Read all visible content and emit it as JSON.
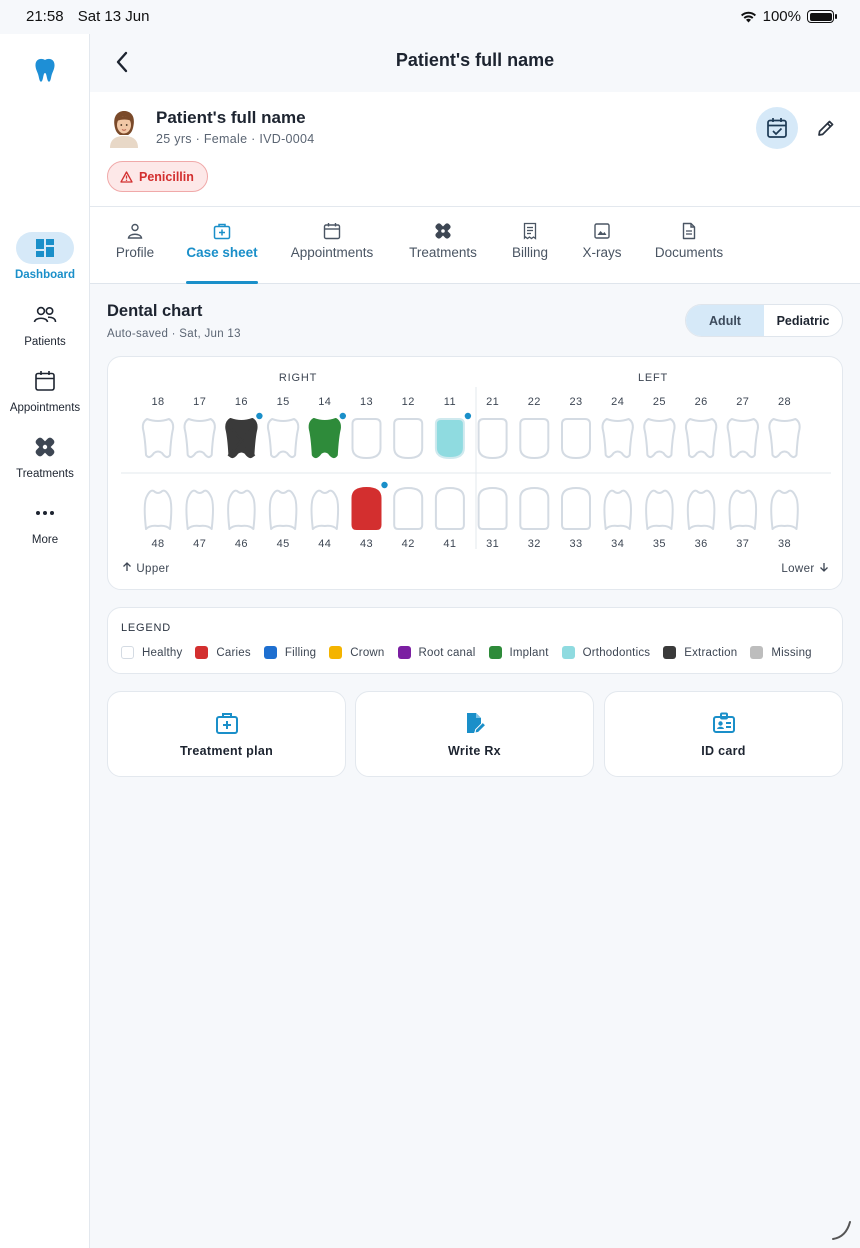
{
  "status_bar": {
    "time": "21:58",
    "date": "Sat 13 Jun",
    "battery": "100%",
    "battery_level": 1.0
  },
  "sidebar": {
    "items": [
      {
        "label": "Dashboard",
        "icon": "dashboard-icon",
        "active": true
      },
      {
        "label": "Patients",
        "icon": "patients-icon"
      },
      {
        "label": "Appointments",
        "icon": "calendar-icon"
      },
      {
        "label": "Treatments",
        "icon": "bandage-icon"
      },
      {
        "label": "More",
        "icon": "more-icon"
      }
    ]
  },
  "header": {
    "title": "Patient's full name"
  },
  "patient": {
    "name": "Patient's full name",
    "meta": "25 yrs · Female · IVD-0004",
    "allergy": "Penicillin"
  },
  "tabs": [
    {
      "label": "Profile",
      "icon": "person-icon"
    },
    {
      "label": "Case sheet",
      "icon": "medical-kit-icon",
      "active": true
    },
    {
      "label": "Appointments",
      "icon": "calendar-icon"
    },
    {
      "label": "Treatments",
      "icon": "bandage-icon"
    },
    {
      "label": "Billing",
      "icon": "receipt-icon"
    },
    {
      "label": "X-rays",
      "icon": "image-icon"
    },
    {
      "label": "Documents",
      "icon": "document-icon"
    }
  ],
  "dental_chart": {
    "title": "Dental chart",
    "subtitle": "Auto-saved · Sat, Jun 13",
    "mode_options": [
      "Adult",
      "Pediatric"
    ],
    "selected_mode": "Adult",
    "right_label": "RIGHT",
    "left_label": "LEFT",
    "upper_label": "Upper",
    "lower_label": "Lower",
    "upper_teeth": [
      {
        "num": "18",
        "status": "healthy"
      },
      {
        "num": "17",
        "status": "healthy"
      },
      {
        "num": "16",
        "status": "extraction",
        "note": true
      },
      {
        "num": "15",
        "status": "healthy"
      },
      {
        "num": "14",
        "status": "implant",
        "note": true
      },
      {
        "num": "13",
        "status": "healthy"
      },
      {
        "num": "12",
        "status": "healthy"
      },
      {
        "num": "11",
        "status": "orthodontics",
        "note": true
      },
      {
        "num": "21",
        "status": "healthy"
      },
      {
        "num": "22",
        "status": "healthy"
      },
      {
        "num": "23",
        "status": "healthy"
      },
      {
        "num": "24",
        "status": "healthy"
      },
      {
        "num": "25",
        "status": "healthy"
      },
      {
        "num": "26",
        "status": "healthy"
      },
      {
        "num": "27",
        "status": "healthy"
      },
      {
        "num": "28",
        "status": "healthy"
      }
    ],
    "lower_teeth": [
      {
        "num": "48",
        "status": "healthy"
      },
      {
        "num": "47",
        "status": "healthy"
      },
      {
        "num": "46",
        "status": "healthy"
      },
      {
        "num": "45",
        "status": "healthy"
      },
      {
        "num": "44",
        "status": "healthy"
      },
      {
        "num": "43",
        "status": "caries",
        "note": true
      },
      {
        "num": "42",
        "status": "healthy"
      },
      {
        "num": "41",
        "status": "healthy"
      },
      {
        "num": "31",
        "status": "healthy"
      },
      {
        "num": "32",
        "status": "healthy"
      },
      {
        "num": "33",
        "status": "healthy"
      },
      {
        "num": "34",
        "status": "healthy"
      },
      {
        "num": "35",
        "status": "healthy"
      },
      {
        "num": "36",
        "status": "healthy"
      },
      {
        "num": "37",
        "status": "healthy"
      },
      {
        "num": "38",
        "status": "healthy"
      }
    ]
  },
  "legend": {
    "title": "LEGEND",
    "items": [
      {
        "label": "Healthy",
        "key": "healthy",
        "color": "#ffffff"
      },
      {
        "label": "Caries",
        "key": "caries",
        "color": "#d32f2f"
      },
      {
        "label": "Filling",
        "key": "filling",
        "color": "#1e6fd0"
      },
      {
        "label": "Crown",
        "key": "crown",
        "color": "#f4b400"
      },
      {
        "label": "Root canal",
        "key": "root_canal",
        "color": "#7b1fa2"
      },
      {
        "label": "Implant",
        "key": "implant",
        "color": "#2e8b3a"
      },
      {
        "label": "Orthodontics",
        "key": "orthodontics",
        "color": "#8fdbe0"
      },
      {
        "label": "Extraction",
        "key": "extraction",
        "color": "#3a3a3a"
      },
      {
        "label": "Missing",
        "key": "missing",
        "color": "#bdbdbd"
      }
    ]
  },
  "actions": [
    {
      "label": "Treatment plan",
      "icon": "medical-kit-icon"
    },
    {
      "label": "Write Rx",
      "icon": "prescription-edit-icon"
    },
    {
      "label": "ID card",
      "icon": "id-card-icon"
    }
  ],
  "colors": {
    "accent": "#1a8fc9",
    "note_dot": "#1a8fc9",
    "tooth_outline": "#d4dbe3"
  }
}
